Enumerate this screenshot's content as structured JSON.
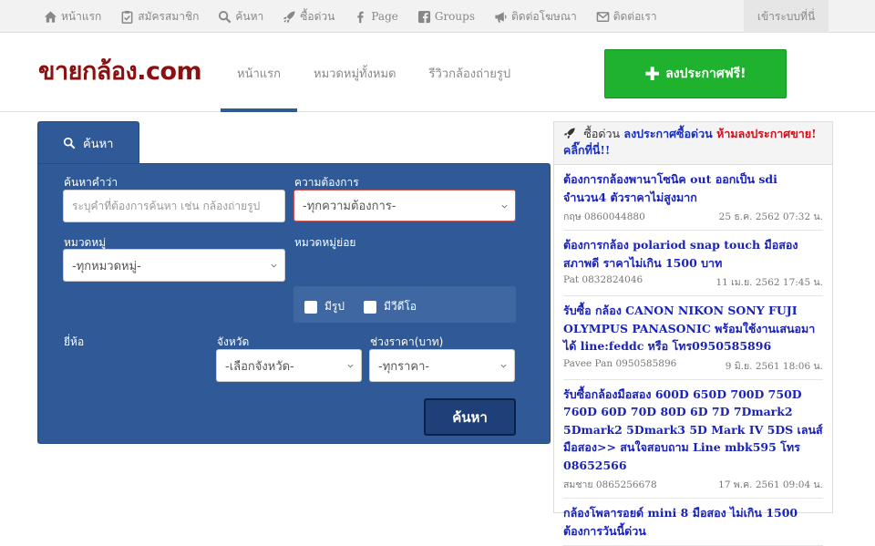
{
  "topbar": {
    "items": [
      {
        "label": "หน้าแรก",
        "icon": "home-icon"
      },
      {
        "label": "สมัครสมาชิก",
        "icon": "clipboard-icon"
      },
      {
        "label": "ค้นหา",
        "icon": "search-icon"
      },
      {
        "label": "ซื้อด่วน",
        "icon": "rocket-icon"
      },
      {
        "label": "Page",
        "icon": "facebook-icon"
      },
      {
        "label": "Groups",
        "icon": "facebook-square-icon"
      },
      {
        "label": "ติดต่อโฆษณา",
        "icon": "megaphone-icon"
      },
      {
        "label": "ติดต่อเรา",
        "icon": "envelope-icon"
      }
    ],
    "login_label": "เข้าระบบที่นี่"
  },
  "header": {
    "logo": "ขายกล้อง.com",
    "nav": [
      {
        "label": "หน้าแรก",
        "active": true
      },
      {
        "label": "หมวดหมู่ทั้งหมด",
        "active": false
      },
      {
        "label": "รีวิวกล้องถ่ายรูป",
        "active": false
      }
    ],
    "post_button": "ลงประกาศฟรี!"
  },
  "search": {
    "tab_label": "ค้นหา",
    "keyword_label": "ค้นหาคำว่า",
    "keyword_placeholder": "ระบุคำที่ต้องการค้นหา เช่น กล้องถ่ายรูป",
    "need_label": "ความต้องการ",
    "need_value": "-ทุกความต้องการ-",
    "category_label": "หมวดหมู่",
    "category_value": "-ทุกหมวดหมู่-",
    "subcategory_label": "หมวดหมู่ย่อย",
    "has_photo_label": "มีรูป",
    "has_video_label": "มีวีดีโอ",
    "brand_label": "ยี่ห้อ",
    "province_label": "จังหวัด",
    "province_value": "-เลือกจังหวัด-",
    "price_label": "ช่วงราคา(บาท)",
    "price_value": "-ทุกราคา-",
    "submit_label": "ค้นหา"
  },
  "sidebar": {
    "head_prefix": "ซื้อด่วน",
    "head_blue": "ลงประกาศซื้อด่วน",
    "head_red": "ห้ามลงประกาศขาย!",
    "head_click": "คลิ๊กที่นี่!!",
    "items": [
      {
        "title": "ต้องการกล้องพานาโซนิค out ออกเป็น sdi จำนวน4 ตัวราคาไม่สูงมาก",
        "author": "กฤษ 0860044880",
        "date": "25 ธ.ค. 2562 07:32 น."
      },
      {
        "title": "ต้องการกล้อง polariod snap touch มือสอง สภาพดี ราคาไม่เกิน 1500 บาท",
        "author": "Pat 0832824046",
        "date": "11 เม.ย. 2562 17:45 น."
      },
      {
        "title": "รับซื้อ กล้อง CANON NIKON SONY FUJI OLYMPUS PANASONIC พร้อมใช้งานเสนอมาได้ line:feddc หรือ โทร0950585896",
        "author": "Pavee Pan 0950585896",
        "date": "9 มิ.ย. 2561 18:06 น."
      },
      {
        "title": "รับซื้อกล้องมือสอง 600D 650D 700D 750D 760D 60D 70D 80D 6D 7D 7Dmark2 5Dmark2 5Dmark3 5D Mark IV 5DS เลนส์มือสอง>> สนใจสอบถาม Line mbk595 โทร 08652566",
        "author": "สมชาย 0865256678",
        "date": "17 พ.ค. 2561 09:04 น."
      },
      {
        "title": "กล้องโพลารอยด์ mini 8 มือสอง ไม่เกิน 1500 ต้องการวันนี้ด่วน",
        "author": "",
        "date": ""
      }
    ]
  }
}
